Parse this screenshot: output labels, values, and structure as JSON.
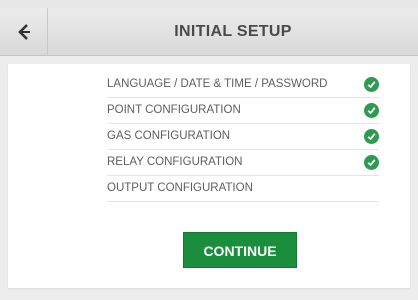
{
  "header": {
    "title": "INITIAL SETUP",
    "back_icon": "chevron-left-icon"
  },
  "steps": [
    {
      "label": "LANGUAGE / DATE & TIME / PASSWORD",
      "completed": true
    },
    {
      "label": "POINT CONFIGURATION",
      "completed": true
    },
    {
      "label": "GAS CONFIGURATION",
      "completed": true
    },
    {
      "label": "RELAY CONFIGURATION",
      "completed": true
    },
    {
      "label": "OUTPUT CONFIGURATION",
      "completed": false
    }
  ],
  "continue_label": "CONTINUE",
  "colors": {
    "accent_green": "#1b8e3e",
    "check_green": "#2e9a52",
    "header_text": "#4a4a4a"
  }
}
